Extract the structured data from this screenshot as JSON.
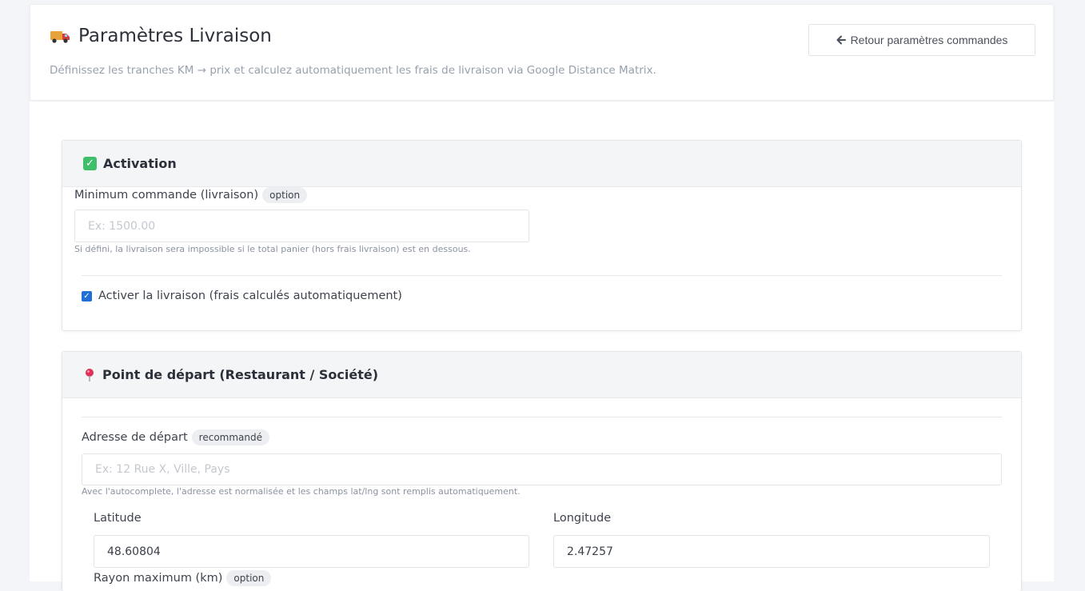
{
  "header": {
    "title": "Paramètres Livraison",
    "subtitle": "Définissez les tranches KM → prix et calculez automatiquement les frais de livraison via Google Distance Matrix.",
    "back_button": "Retour paramètres commandes"
  },
  "activation": {
    "title": "Activation",
    "min_order_label": "Minimum commande (livraison)",
    "min_order_badge": "option",
    "min_order_placeholder": "Ex: 1500.00",
    "min_order_help": "Si défini, la livraison sera impossible si le total panier (hors frais livraison) est en dessous.",
    "enable_label": "Activer la livraison (frais calculés automatiquement)",
    "enable_checked": true
  },
  "departure": {
    "title": "Point de départ (Restaurant / Société)",
    "address_label": "Adresse de départ",
    "address_badge": "recommandé",
    "address_placeholder": "Ex: 12 Rue X, Ville, Pays",
    "address_help": "Avec l'autocomplete, l'adresse est normalisée et les champs lat/lng sont remplis automatiquement.",
    "latitude_label": "Latitude",
    "latitude_value": "48.60804",
    "longitude_label": "Longitude",
    "longitude_value": "2.47257",
    "radius_label": "Rayon maximum (km)",
    "radius_badge": "option"
  },
  "colors": {
    "accent": "#1f6fd6",
    "check_green": "#3fbf6a"
  }
}
